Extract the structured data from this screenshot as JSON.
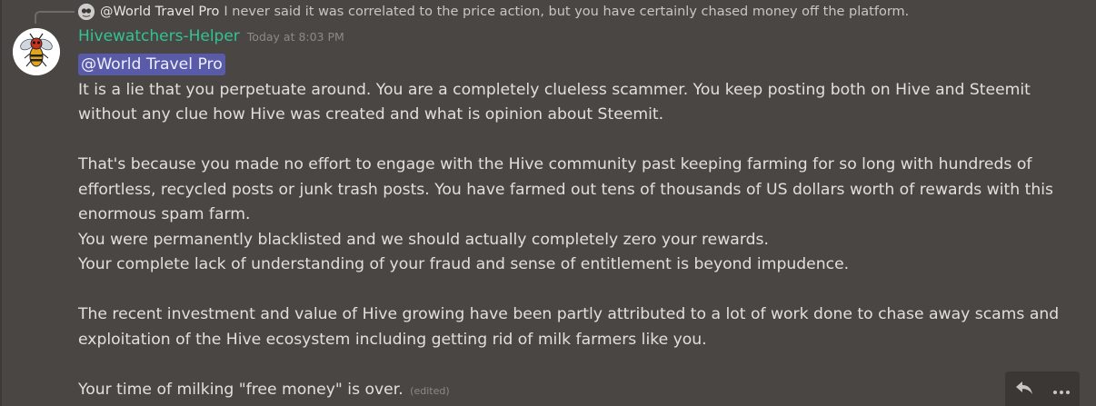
{
  "reply": {
    "author": "@World Travel Pro",
    "text": "I never said it was correlated to the price action, but you have certainly chased money off the platform.",
    "avatar_icon": "user-avatar-icon"
  },
  "message": {
    "author": "Hivewatchers-Helper",
    "timestamp": "Today at 8:03 PM",
    "mention": "@World Travel Pro",
    "paragraphs": [
      "It is a lie that you perpetuate around. You are a completely clueless scammer. You keep posting both on Hive and Steemit without any clue how Hive was created and what is opinion about Steemit.",
      "That's because you made no effort to engage with the Hive community past keeping farming for so long with hundreds of effortless, recycled posts or junk trash posts. You have farmed out tens of thousands of US dollars worth of rewards with this enormous spam farm.",
      "You were permanently blacklisted and we should actually completely zero your rewards.",
      "Your complete lack of understanding of your fraud and sense of entitlement is beyond impudence.",
      "The recent investment and value of Hive growing have been partly attributed to a lot of work done to chase away scams and exploitation of the Hive ecosystem including getting rid of milk farmers like you.",
      "Your time of milking \"free money\" is over."
    ],
    "edited_label": "(edited)",
    "avatar_icon": "hornet-avatar-icon"
  },
  "actions": {
    "reply_icon": "reply-icon",
    "more_icon": "more-options-icon"
  },
  "colors": {
    "background": "#4a4643",
    "author_name": "#31c393",
    "mention_bg": "#5a5ba8",
    "body_text": "#e2dfdb",
    "muted": "#8d8984"
  }
}
